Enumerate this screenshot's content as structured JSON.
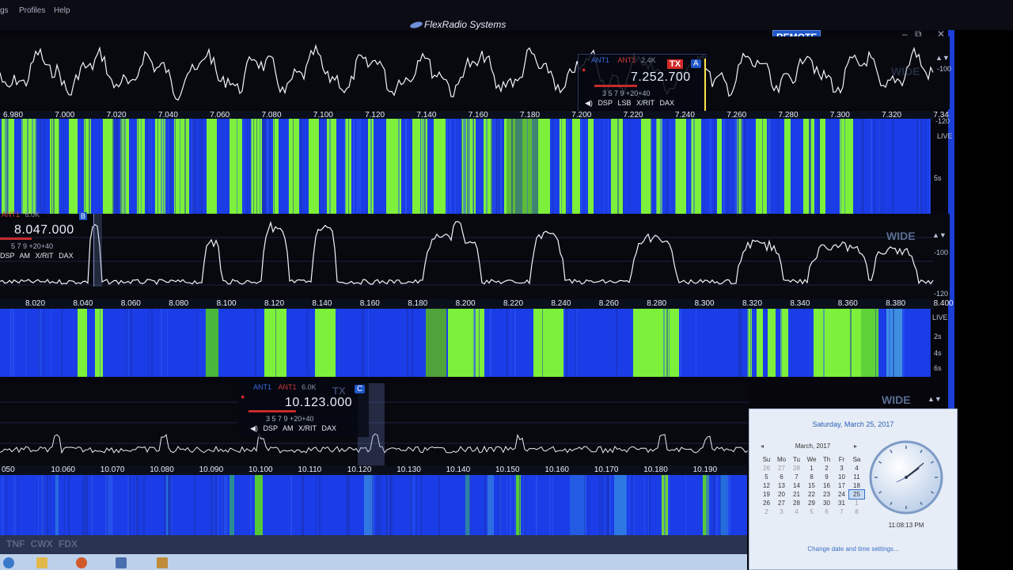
{
  "menu": {
    "settings": "gs",
    "profiles": "Profiles",
    "help": "Help"
  },
  "app": {
    "title": "FlexRadio Systems",
    "remote_label": "REMOTE",
    "min": "–",
    "max": "⧉",
    "close": "✕"
  },
  "colors": {
    "accent": "#1f56c8",
    "wf_green": "#7cf03a",
    "wf_blue": "#1a3de8"
  },
  "panadapter1": {
    "ticks": [
      "6.980",
      "7.000",
      "7.020",
      "7.040",
      "7.060",
      "7.080",
      "7.100",
      "7.120",
      "7.140",
      "7.160",
      "7.180",
      "7.200",
      "7.220",
      "7.240",
      "7.260",
      "7.280",
      "7.300",
      "7.320",
      "7.34"
    ],
    "ref_top": "-100",
    "ref_bottom": "-120",
    "wide": "WIDE",
    "live": "LIVE",
    "wf_time": "5s",
    "slice": {
      "ant1": "ANT1",
      "ant2": "ANT1",
      "bw": "2.4K",
      "tx": "TX",
      "letter": "A",
      "freq": "7.252.700",
      "nums": "3  5  7  9 +20+40",
      "dsp": "DSP",
      "mode": "LSB",
      "xrit": "X/RIT",
      "dax": "DAX"
    }
  },
  "panadapter2": {
    "ticks": [
      "8.020",
      "8.040",
      "8.060",
      "8.080",
      "8.100",
      "8.120",
      "8.140",
      "8.160",
      "8.180",
      "8.200",
      "8.220",
      "8.240",
      "8.260",
      "8.280",
      "8.300",
      "8.320",
      "8.340",
      "8.360",
      "8.380",
      "8.400"
    ],
    "ref_top": "-100",
    "ref_bottom": "-120",
    "wide": "WIDE",
    "live": "LIVE",
    "wf_times": [
      "2s",
      "4s",
      "6s"
    ],
    "slice": {
      "ant1": "ANT1",
      "bw": "6.0K",
      "letter": "B",
      "freq": "8.047.000",
      "nums": "5  7  9 +20+40",
      "dsp": "DSP",
      "mode": "AM",
      "xrit": "X/RIT",
      "dax": "DAX"
    }
  },
  "panadapter3": {
    "ticks": [
      "050",
      "10.060",
      "10.070",
      "10.080",
      "10.090",
      "10.100",
      "10.110",
      "10.120",
      "10.130",
      "10.140",
      "10.150",
      "10.160",
      "10.170",
      "10.180",
      "10.190"
    ],
    "wide": "WIDE",
    "slice": {
      "ant1": "ANT1",
      "ant2": "ANT1",
      "bw": "6.0K",
      "tx": "TX",
      "letter": "C",
      "freq": "10.123.000",
      "nums": "3  5  7  9 +20+40",
      "dsp": "DSP",
      "mode": "AM",
      "xrit": "X/RIT",
      "dax": "DAX"
    }
  },
  "bottom": {
    "tnf": "TNF",
    "cwx": "CWX",
    "fdx": "FDX"
  },
  "calendar": {
    "full_date": "Saturday, March 25, 2017",
    "month": "March, 2017",
    "weekdays": [
      "Su",
      "Mo",
      "Tu",
      "We",
      "Th",
      "Fr",
      "Sa"
    ],
    "weeks": [
      [
        "26",
        "27",
        "28",
        "1",
        "2",
        "3",
        "4"
      ],
      [
        "5",
        "6",
        "7",
        "8",
        "9",
        "10",
        "11"
      ],
      [
        "12",
        "13",
        "14",
        "15",
        "16",
        "17",
        "18"
      ],
      [
        "19",
        "20",
        "21",
        "22",
        "23",
        "24",
        "25"
      ],
      [
        "26",
        "27",
        "28",
        "29",
        "30",
        "31",
        "1"
      ],
      [
        "2",
        "3",
        "4",
        "5",
        "6",
        "7",
        "8"
      ]
    ],
    "time": "11:08:13 PM",
    "link": "Change date and time settings..."
  }
}
